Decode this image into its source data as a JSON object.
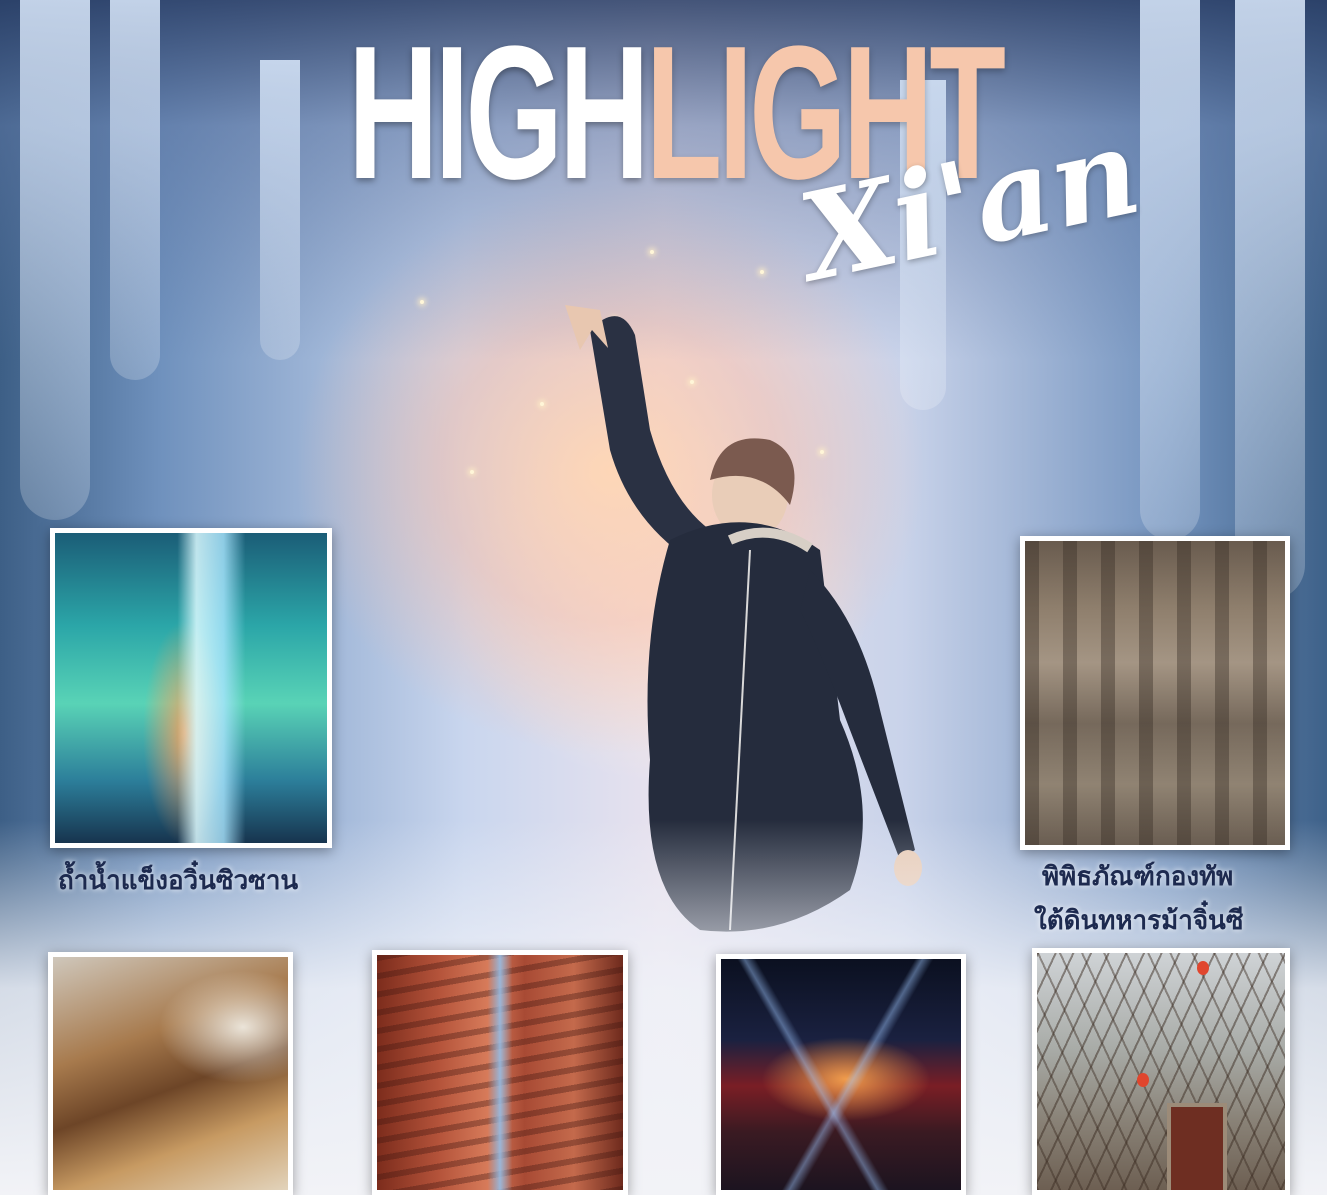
{
  "title": {
    "part1": "HIGH",
    "part2": "LIGHT",
    "script": "Xi'an"
  },
  "colors": {
    "title_white": "#ffffff",
    "title_peach": "#f6c7ac",
    "caption_navy": "#1d2a4f"
  },
  "attractions": {
    "ice_cave": {
      "caption": "ถ้ำน้ำแข็งอวิ๋นซิวซาน"
    },
    "terracotta": {
      "caption_line1": "พิพิธภัณฑ์กองทัพ",
      "caption_line2": "ใต้ดินทหารม้าจิ๋นซี"
    }
  }
}
